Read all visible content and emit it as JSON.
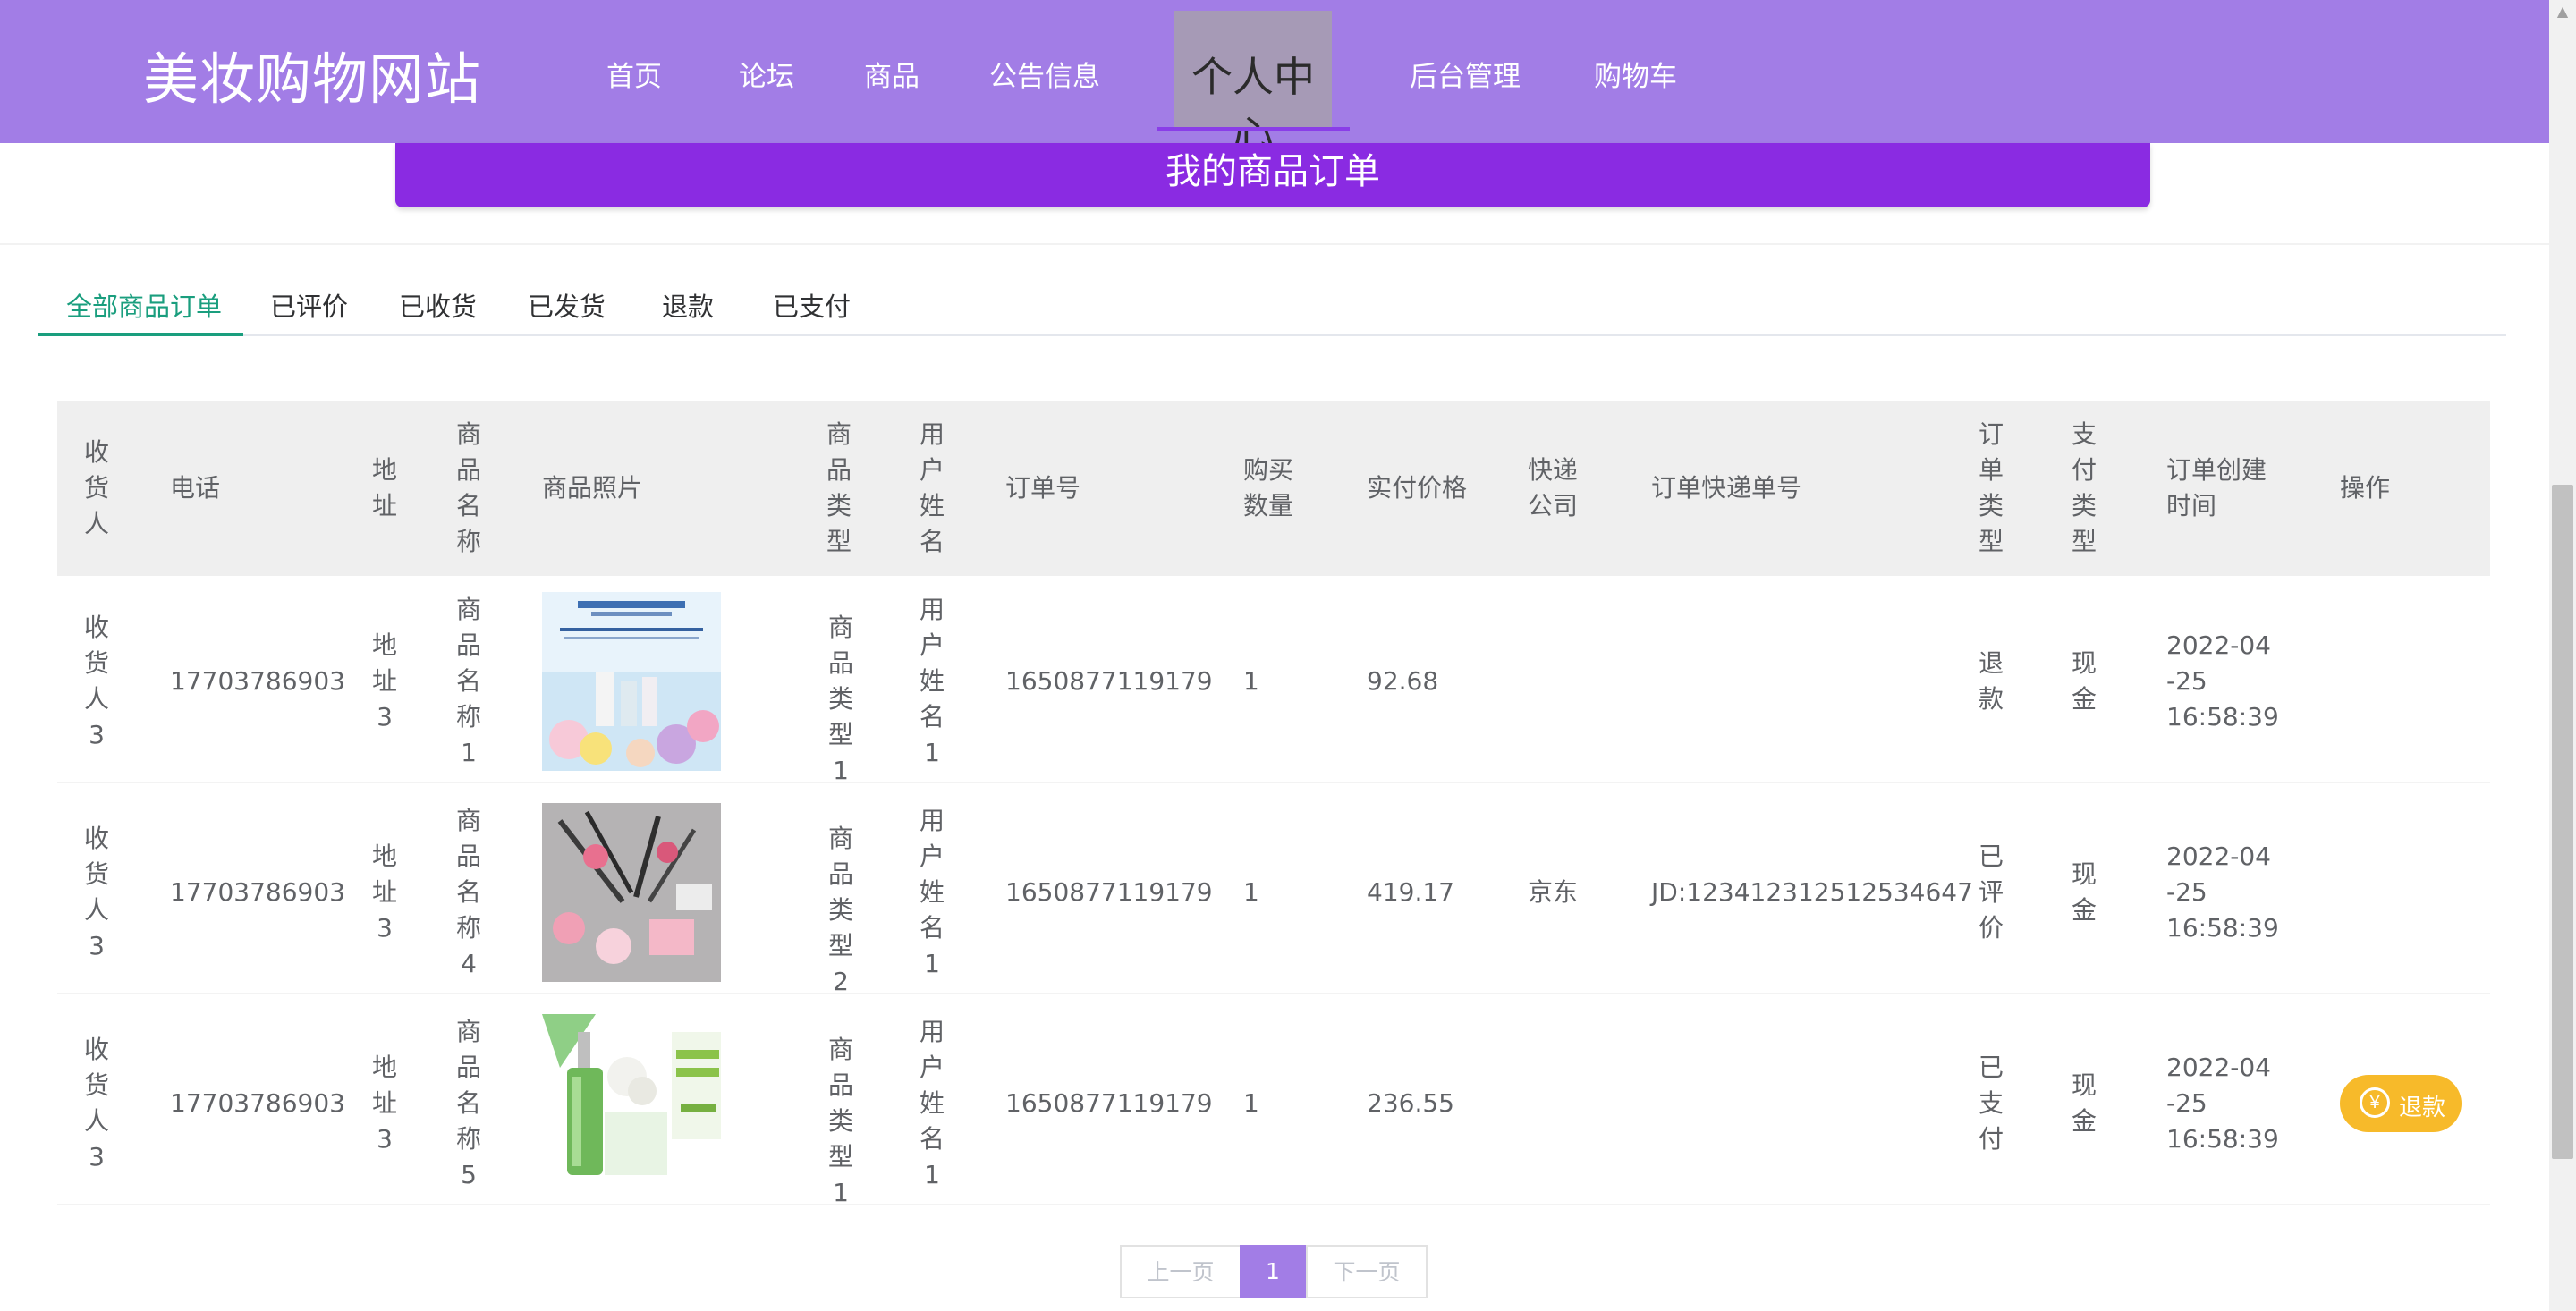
{
  "header": {
    "brand": "美妆购物网站",
    "nav": [
      "首页",
      "论坛",
      "商品",
      "公告信息",
      "个人中心",
      "后台管理",
      "购物车"
    ],
    "active_nav": "个人中心"
  },
  "banner": {
    "title": "我的商品订单"
  },
  "tabs": {
    "items": [
      "全部商品订单",
      "已评价",
      "已收货",
      "已发货",
      "退款",
      "已支付"
    ],
    "active": "全部商品订单"
  },
  "table": {
    "columns": [
      "收货人",
      "电话",
      "地址",
      "商品名称",
      "商品照片",
      "商品类型",
      "用户姓名",
      "订单号",
      "购买数量",
      "实付价格",
      "快递公司",
      "订单快递单号",
      "订单类型",
      "支付类型",
      "订单创建时间",
      "操作"
    ],
    "rows": [
      {
        "receiver": "收货人3",
        "phone": "17703786903",
        "address": "地址3",
        "product_name": "商品名称1",
        "product_type": "商品类型1",
        "user_name": "用户姓名1",
        "order_no": "1650877119179",
        "quantity": "1",
        "price": "92.68",
        "courier": "",
        "tracking_no": "",
        "order_type": "退款",
        "pay_type": "现金",
        "created_date": "2022-04-25",
        "created_time": "16:58:39",
        "action": ""
      },
      {
        "receiver": "收货人3",
        "phone": "17703786903",
        "address": "地址3",
        "product_name": "商品名称4",
        "product_type": "商品类型2",
        "user_name": "用户姓名1",
        "order_no": "1650877119179",
        "quantity": "1",
        "price": "419.17",
        "courier": "京东",
        "tracking_no": "JD:123412312512534647",
        "order_type": "已评价",
        "pay_type": "现金",
        "created_date": "2022-04-25",
        "created_time": "16:58:39",
        "action": ""
      },
      {
        "receiver": "收货人3",
        "phone": "17703786903",
        "address": "地址3",
        "product_name": "商品名称5",
        "product_type": "商品类型1",
        "user_name": "用户姓名1",
        "order_no": "1650877119179",
        "quantity": "1",
        "price": "236.55",
        "courier": "",
        "tracking_no": "",
        "order_type": "已支付",
        "pay_type": "现金",
        "created_date": "2022-04-25",
        "created_time": "16:58:39",
        "action": "退款"
      }
    ],
    "refund_icon": "yen-icon"
  },
  "pagination": {
    "prev": "上一页",
    "current": "1",
    "next": "下一页"
  },
  "colors": {
    "header_bg": "#a27de6",
    "banner_bg": "#8a2be2",
    "tab_active": "#1a9e7e",
    "refund_btn": "#f7ba2a"
  }
}
